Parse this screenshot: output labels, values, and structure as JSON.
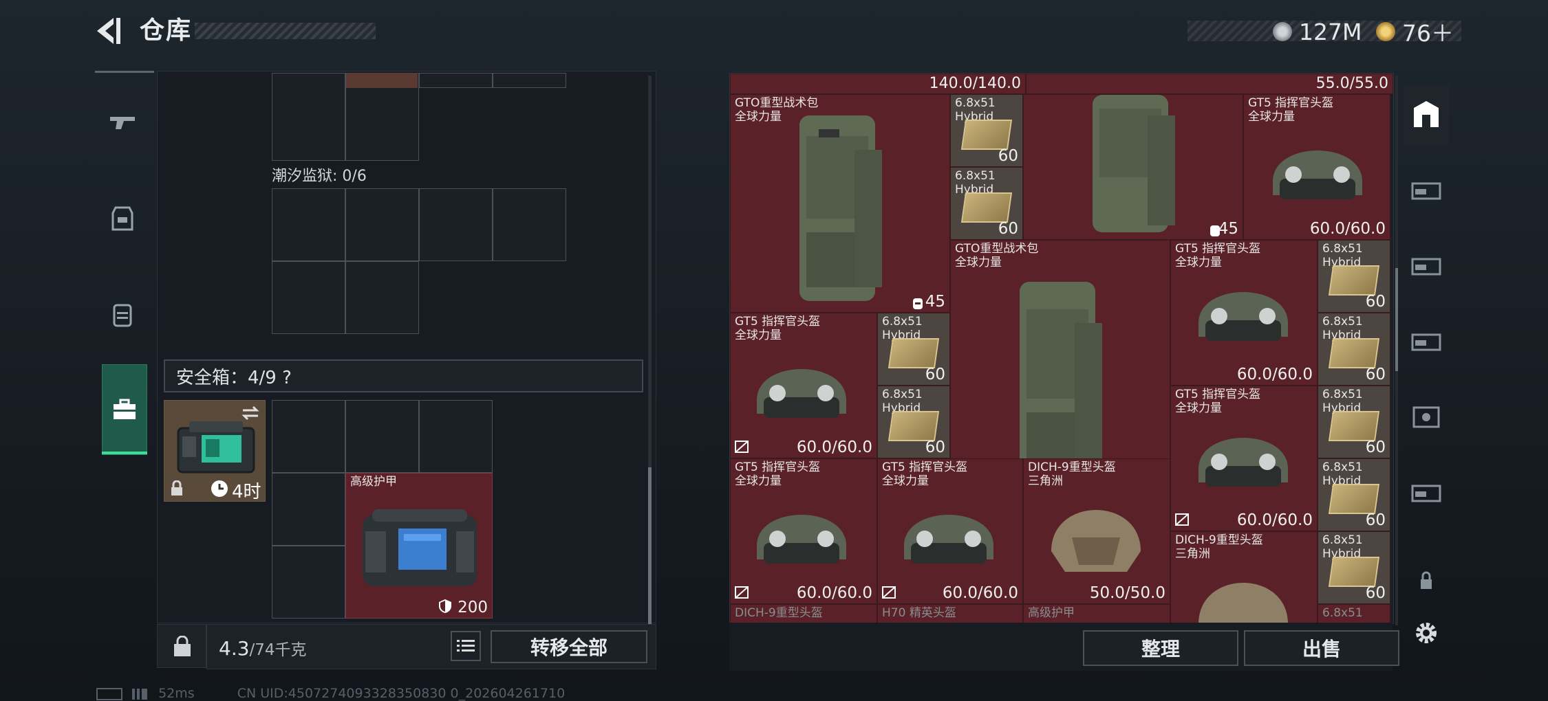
{
  "header": {
    "title": "仓库",
    "currency_silver": "127M",
    "currency_gold": "76＋"
  },
  "left": {
    "prison_label": "潮汐监狱: 0/6",
    "safe_label": "安全箱：4/9  ?",
    "secure_case_time": "4时",
    "armor_item": {
      "name": "高级护甲",
      "value": "200"
    },
    "weight_current": "4.3",
    "weight_total": "/74千克",
    "transfer_all": "转移全部"
  },
  "right": {
    "top_values": [
      "140.0/140.0",
      "55.0/55.0"
    ],
    "bag_name": "GTO重型战术包\n全球力量",
    "bag_value": "45",
    "helmet_name": "GT5 指挥官头盔\n全球力量",
    "helmet_value": "60.0/60.0",
    "ammo_name": "6.8x51\nHybrid",
    "ammo_value": "60",
    "dich_name": "DICH-9重型头盔\n三角洲",
    "dich_value": "50.0/50.0",
    "bottom_labels": [
      "DICH-9重型头盔",
      "H70 精英头盔",
      "高级护甲",
      "6.8x51"
    ],
    "sort_button": "整理",
    "sell_button": "出售"
  },
  "status": {
    "ping": "52ms",
    "uid": "CN UID:4507274093328350830 0_202604261710"
  },
  "colors": {
    "item_bg": "#5b2128",
    "accent": "#3ddc97"
  }
}
